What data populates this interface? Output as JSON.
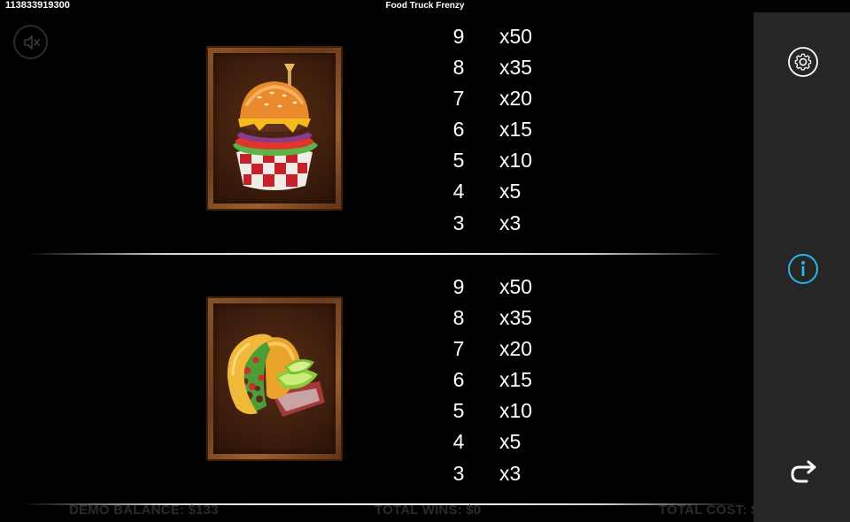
{
  "header": {
    "session_id": "113833919300",
    "title": "Food Truck Frenzy"
  },
  "controls": {
    "mute_icon": "speaker-muted-icon"
  },
  "paytable": [
    {
      "symbol": "burger",
      "pays": [
        {
          "count": "9",
          "multiplier": "x50"
        },
        {
          "count": "8",
          "multiplier": "x35"
        },
        {
          "count": "7",
          "multiplier": "x20"
        },
        {
          "count": "6",
          "multiplier": "x15"
        },
        {
          "count": "5",
          "multiplier": "x10"
        },
        {
          "count": "4",
          "multiplier": "x5"
        },
        {
          "count": "3",
          "multiplier": "x3"
        }
      ]
    },
    {
      "symbol": "taco",
      "pays": [
        {
          "count": "9",
          "multiplier": "x50"
        },
        {
          "count": "8",
          "multiplier": "x35"
        },
        {
          "count": "7",
          "multiplier": "x20"
        },
        {
          "count": "6",
          "multiplier": "x15"
        },
        {
          "count": "5",
          "multiplier": "x10"
        },
        {
          "count": "4",
          "multiplier": "x5"
        },
        {
          "count": "3",
          "multiplier": "x3"
        }
      ]
    }
  ],
  "footer": {
    "balance": "DEMO BALANCE: $133",
    "total_wins": "TOTAL WINS: $0",
    "total_cost": "TOTAL COST: $"
  },
  "sidebar": {
    "settings_icon": "gear-icon",
    "info_icon": "info-icon",
    "back_icon": "return-arrow-icon",
    "accent_color": "#29b6e8"
  }
}
